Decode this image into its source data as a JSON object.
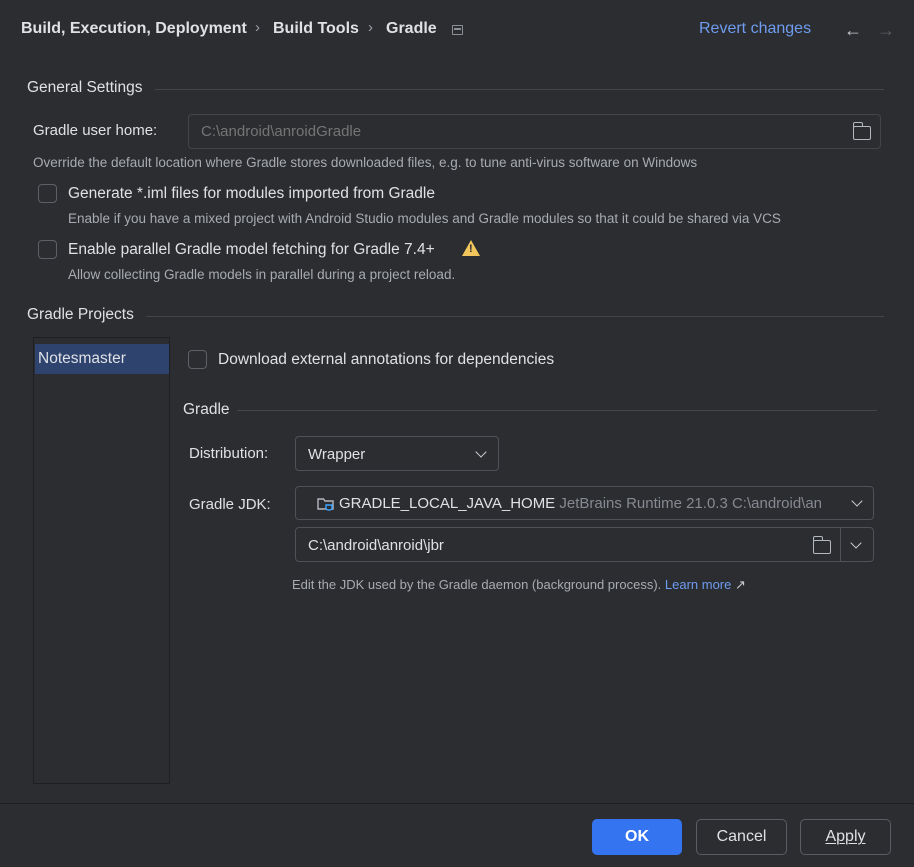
{
  "header": {
    "breadcrumb": [
      "Build, Execution, Deployment",
      "Build Tools",
      "Gradle"
    ],
    "separator": "›",
    "revert_label": "Revert changes",
    "back_icon": "←",
    "forward_icon": "→"
  },
  "general": {
    "title": "General Settings",
    "user_home_label": "Gradle user home:",
    "user_home_placeholder": "C:\\android\\anroidGradle",
    "user_home_hint": "Override the default location where Gradle stores downloaded files, e.g. to tune anti-virus software on Windows",
    "iml_checkbox": {
      "label": "Generate *.iml files for modules imported from Gradle",
      "hint": "Enable if you have a mixed project with Android Studio modules and Gradle modules so that it could be shared via VCS",
      "checked": false
    },
    "parallel_checkbox": {
      "label": "Enable parallel Gradle model fetching for Gradle 7.4+",
      "hint": "Allow collecting Gradle models in parallel during a project reload.",
      "checked": false
    }
  },
  "projects": {
    "title": "Gradle Projects",
    "items": [
      "Notesmaster"
    ],
    "selected": "Notesmaster",
    "annotations_checkbox": {
      "label": "Download external annotations for dependencies",
      "checked": false
    },
    "gradle_section": {
      "title": "Gradle",
      "distribution_label": "Distribution:",
      "distribution_value": "Wrapper",
      "jdk_label": "Gradle JDK:",
      "jdk_name": "GRADLE_LOCAL_JAVA_HOME",
      "jdk_detail": "JetBrains Runtime 21.0.3 C:\\android\\an",
      "jdk_path": "C:\\android\\anroid\\jbr",
      "jdk_hint": "Edit the JDK used by the Gradle daemon (background process).",
      "learn_more": "Learn more",
      "learn_more_arrow": "↗"
    }
  },
  "footer": {
    "ok": "OK",
    "cancel": "Cancel",
    "apply": "Apply"
  },
  "colors": {
    "background": "#2b2d30",
    "accent": "#3574f0",
    "link": "#6f9cf0",
    "selection": "#2e436e",
    "warning": "#f2c55c"
  }
}
